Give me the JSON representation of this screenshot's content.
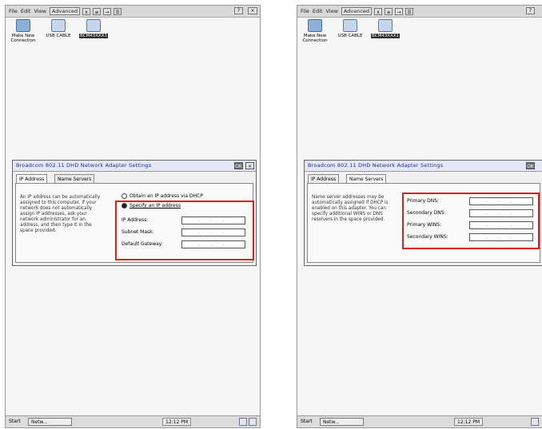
{
  "menu": {
    "file": "File",
    "edit": "Edit",
    "view": "View",
    "advanced": "Advanced",
    "toolbar_buttons": [
      "x",
      "≡",
      "→",
      "☰"
    ],
    "help_button": "?",
    "close_button": "×"
  },
  "desktop": {
    "icons": [
      {
        "label": "Make New Connection",
        "icon": "new-connection-icon"
      },
      {
        "label": "USB CABLE",
        "icon": "usb-cable-icon"
      },
      {
        "label": "BCM43XXX1",
        "icon": "network-adapter-icon"
      }
    ]
  },
  "dialog": {
    "title": "Broadcom 802.11 DHD Network Adapter Settings",
    "ok": "OK",
    "close": "×",
    "tabs": [
      "IP Address",
      "Name Servers"
    ]
  },
  "ip_tab": {
    "description": "An IP address can be automatically assigned to this computer. If your network does not automatically assign IP addresses, ask your network administrator for an address, and then type it in the space provided.",
    "dhcp_option": "Obtain an IP address via DHCP",
    "specify_option": "Specify an IP address",
    "fields": [
      {
        "label": "IP Address:",
        "value": ". . ."
      },
      {
        "label": "Subnet Mask:",
        "value": ". . ."
      },
      {
        "label": "Default Gateway:",
        "value": ". . ."
      }
    ]
  },
  "ns_tab": {
    "description": "Name server addresses may be automatically assigned if DHCP is enabled on this adapter. You can specify additional WINS or DNS resolvers in the space provided.",
    "fields": [
      {
        "label": "Primary DNS:",
        "value": ". . ."
      },
      {
        "label": "Secondary DNS:",
        "value": ". . ."
      },
      {
        "label": "Primary WINS:",
        "value": ". . ."
      },
      {
        "label": "Secondary WINS:",
        "value": ". . ."
      }
    ]
  },
  "taskbar": {
    "start": "Start",
    "task": "Netw...",
    "clock": "12:12 PM"
  },
  "colors": {
    "highlight": "#e01b1b",
    "title_text": "#1a2b8a"
  }
}
